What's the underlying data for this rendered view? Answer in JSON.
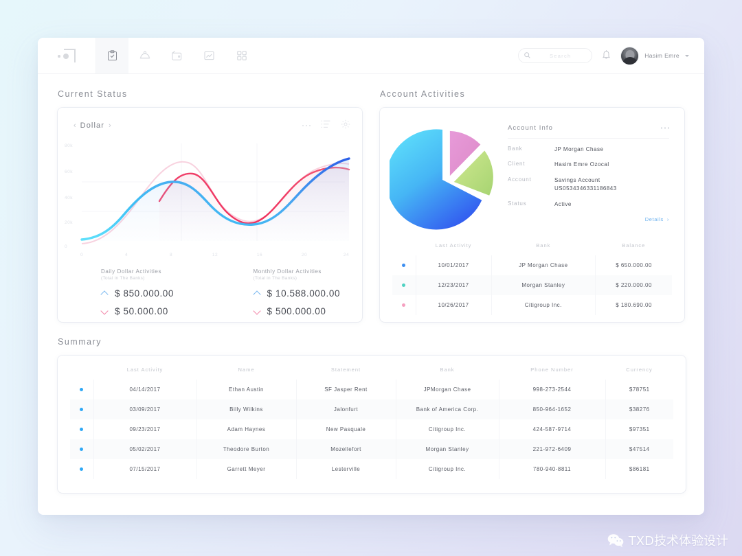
{
  "header": {
    "logo_name": "app-logo",
    "nav_items": [
      {
        "icon": "clipboard-check-icon",
        "active": true
      },
      {
        "icon": "bell-service-icon",
        "active": false
      },
      {
        "icon": "wallet-icon",
        "active": false
      },
      {
        "icon": "image-chart-icon",
        "active": false
      },
      {
        "icon": "grid-apps-icon",
        "active": false
      }
    ],
    "search_placeholder": "Search",
    "search_value": "",
    "notification_icon": "bell-icon",
    "user_name": "Hasim Emre"
  },
  "sections": {
    "current_status": "Current Status",
    "account_activities": "Account Activities",
    "summary": "Summary"
  },
  "status_card": {
    "currency": "Dollar",
    "prev_icon": "chevron-left-icon",
    "next_icon": "chevron-right-icon",
    "more_icon": "more-dots-icon",
    "list_icon": "list-icon",
    "settings_icon": "gear-icon",
    "stats": [
      {
        "title": "Daily Dollar Activities",
        "subtitle": "(Total in The Banks)",
        "up_value": "$ 850.000.00",
        "down_value": "$ 50.000.00"
      },
      {
        "title": "Monthly Dollar Activities",
        "subtitle": "(Total in The Banks)",
        "up_value": "$ 10.588.000.00",
        "down_value": "$ 500.000.00"
      }
    ]
  },
  "chart_data": [
    {
      "type": "line",
      "title": "Dollar",
      "xlabel": "",
      "ylabel": "",
      "x": [
        0,
        4,
        8,
        12,
        16,
        20,
        24
      ],
      "xticklabels": [
        "0",
        "4",
        "8",
        "12",
        "16",
        "20",
        "24"
      ],
      "yticklabels": [
        "80k",
        "60k",
        "40k",
        "20k",
        "0"
      ],
      "ylim": [
        0,
        80000
      ],
      "xlim": [
        0,
        24
      ],
      "grid": true,
      "legend": "none",
      "series": [
        {
          "name": "blue-line",
          "color": "#3a7bec",
          "values": [
            2000,
            23000,
            50000,
            42000,
            30000,
            58000,
            76000
          ]
        },
        {
          "name": "red-line",
          "color": "#ee2f5b",
          "values": [
            null,
            null,
            58000,
            42000,
            30000,
            65000,
            68000
          ]
        },
        {
          "name": "pink-faded-line",
          "color": "#f4a9c0",
          "values": [
            1000,
            14000,
            44000,
            26000,
            22000,
            60000,
            66000
          ]
        }
      ]
    },
    {
      "type": "pie",
      "title": "Account Activities",
      "labels": [
        "JP Morgan Chase",
        "Citigroup Inc.",
        "Morgan Stanley"
      ],
      "values": [
        650000,
        180690,
        220000
      ],
      "percent": [
        70,
        13,
        17
      ],
      "colors": [
        "#46c8f5",
        "#d88fd0",
        "#b8dd7e"
      ]
    }
  ],
  "account_info": {
    "title": "Account Info",
    "more_icon": "more-dots-icon",
    "rows": [
      {
        "key": "Bank",
        "value": "JP Morgan Chase"
      },
      {
        "key": "Client",
        "value": "Hasim Emre Ozocal"
      },
      {
        "key": "Account",
        "value": "Savings Account\nUS0534346331186843"
      },
      {
        "key": "Status",
        "value": "Active"
      }
    ],
    "details_label": "Details",
    "details_icon": "chevron-right-icon"
  },
  "activity_table": {
    "columns": [
      "",
      "Last Activity",
      "Bank",
      "Balance"
    ],
    "rows": [
      {
        "dot": "#3d8ef0",
        "date": "10/01/2017",
        "bank": "JP Morgan Chase",
        "balance": "$ 650.000.00"
      },
      {
        "dot": "#4fd2c2",
        "date": "12/23/2017",
        "bank": "Morgan Stanley",
        "balance": "$ 220.000.00"
      },
      {
        "dot": "#f5a0c0",
        "date": "10/26/2017",
        "bank": "Citigroup Inc.",
        "balance": "$ 180.690.00"
      }
    ]
  },
  "summary_table": {
    "columns": [
      "",
      "Last Activity",
      "Name",
      "Statement",
      "Bank",
      "Phone Number",
      "Currency"
    ],
    "rows": [
      {
        "dot": "#2fa8f5",
        "date": "04/14/2017",
        "name": "Ethan Austin",
        "statement": "SF Jasper Rent",
        "bank": "JPMorgan Chase",
        "phone": "998-273-2544",
        "currency": "$78751"
      },
      {
        "dot": "#2fa8f5",
        "date": "03/09/2017",
        "name": "Billy Wilkins",
        "statement": "Jalonfurt",
        "bank": "Bank of America Corp.",
        "phone": "850-964-1652",
        "currency": "$38276"
      },
      {
        "dot": "#2fa8f5",
        "date": "09/23/2017",
        "name": "Adam Haynes",
        "statement": "New Pasquale",
        "bank": "Citigroup Inc.",
        "phone": "424-587-9714",
        "currency": "$97351"
      },
      {
        "dot": "#2fa8f5",
        "date": "05/02/2017",
        "name": "Theodore Burton",
        "statement": "Mozellefort",
        "bank": "Morgan Stanley",
        "phone": "221-972-6409",
        "currency": "$47514"
      },
      {
        "dot": "#2fa8f5",
        "date": "07/15/2017",
        "name": "Garrett Meyer",
        "statement": "Lesterville",
        "bank": "Citigroup Inc.",
        "phone": "780-940-8811",
        "currency": "$86181"
      }
    ]
  },
  "watermark": {
    "icon": "wechat-icon",
    "text": "TXD技术体验设计"
  }
}
